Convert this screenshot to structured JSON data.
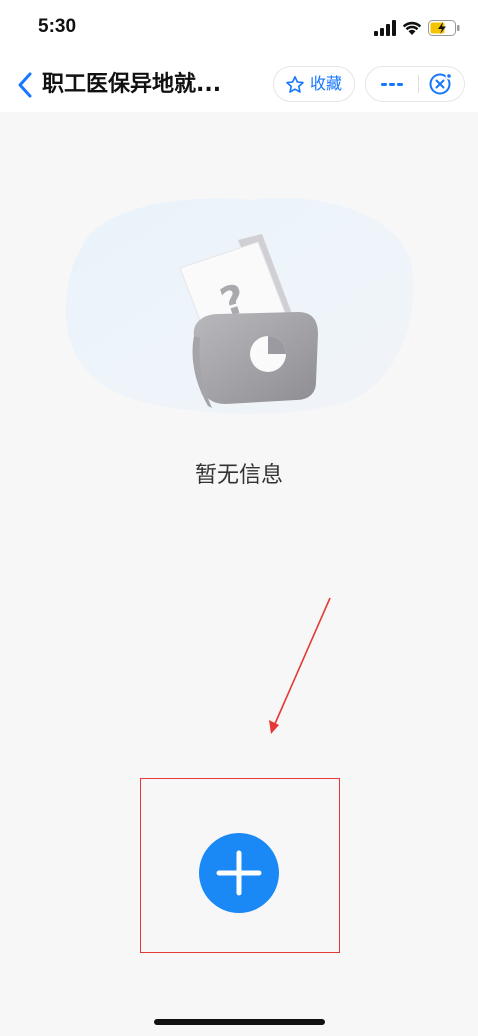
{
  "status_bar": {
    "time": "5:30",
    "icons": [
      "signal-icon",
      "wifi-icon",
      "battery-charging-icon"
    ]
  },
  "nav": {
    "title": "职工医保异地就...",
    "favorite_label": "收藏",
    "icons": [
      "back-chevron-icon",
      "star-icon",
      "more-icon",
      "close-mini-program-icon"
    ]
  },
  "empty_state": {
    "message": "暂无信息",
    "illustration": "document-question-icon"
  },
  "actions": {
    "add_icon": "plus-icon"
  },
  "colors": {
    "accent": "#1677ff",
    "add_button": "#1a88f5",
    "background": "#f7f7f7",
    "annotation": "#e53935"
  }
}
